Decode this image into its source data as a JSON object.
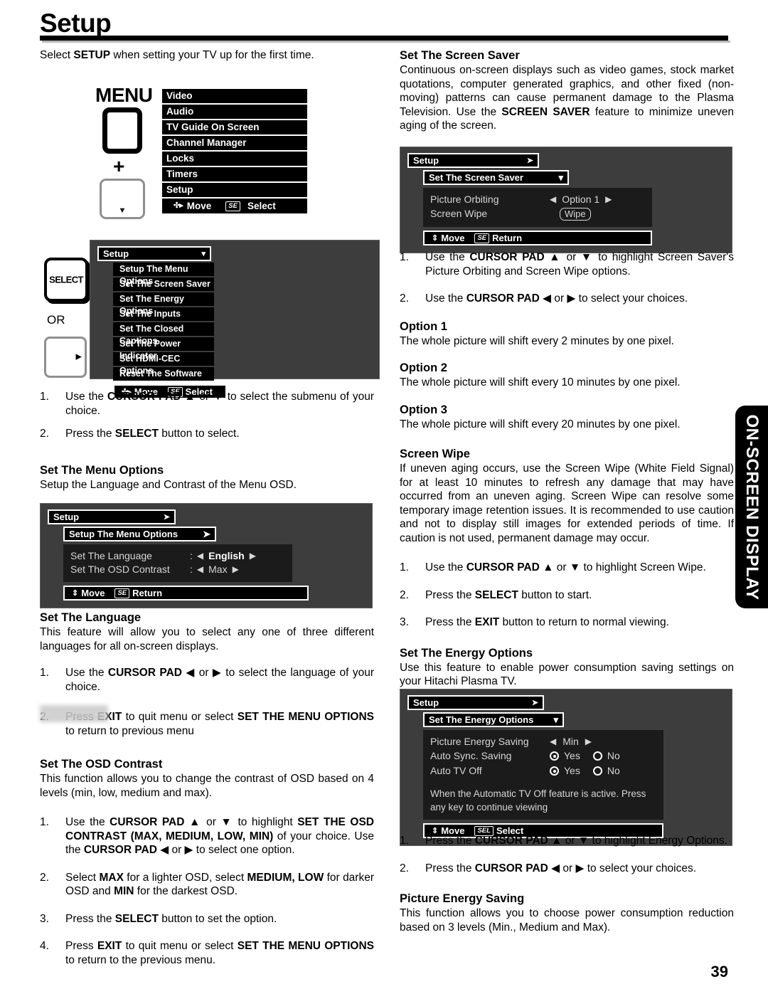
{
  "page": {
    "title": "Setup",
    "number": "39",
    "side_tab": "ON-SCREEN DISPLAY",
    "intro_pre": "Select ",
    "intro_bold": "SETUP",
    "intro_post": " when setting your TV up for the first time."
  },
  "remote": {
    "menu_label": "MENU",
    "plus": "+",
    "down_glyph": "▼",
    "select_label": "SELECT",
    "or_label": "OR",
    "right_glyph": "▶"
  },
  "menu_list": {
    "items": [
      "Video",
      "Audio",
      "TV Guide On Screen",
      "Channel Manager",
      "Locks",
      "Timers",
      "Setup"
    ],
    "move_label": "Move",
    "se_label": "SE",
    "select_label": "Select",
    "move_glyph": "✣▸"
  },
  "osd_setup_list": {
    "header": "Setup",
    "header_arrow": "▾",
    "items": [
      "Setup The Menu Options",
      "Set The Screen Saver",
      "Set The Energy Options",
      "Set The Inputs",
      "Set The Closed Captions",
      "Set The Power Indicator",
      "Set HDMI-CEC Options",
      "Reset The Software"
    ],
    "footer_move": "Move",
    "footer_se": "SE",
    "footer_action": "Select",
    "move_glyph": "✣▸"
  },
  "osd_menu_options": {
    "header": "Setup",
    "header_arrow": "➤",
    "sub": "Setup The Menu Options",
    "sub_arrow": "➤",
    "rows": [
      {
        "name": "Set The Language",
        "colon": ":",
        "left": "◀",
        "value": "English",
        "right": "▶"
      },
      {
        "name": "Set The OSD Contrast",
        "colon": ":",
        "left": "◀",
        "value": "Max",
        "right": "▶"
      }
    ],
    "footer_move": "Move",
    "footer_se": "SE",
    "footer_action": "Return",
    "move_glyph": "⇕"
  },
  "osd_screensaver": {
    "header": "Setup",
    "header_arrow": "➤",
    "sub": "Set The Screen Saver",
    "sub_arrow": "▾",
    "rows": [
      {
        "name": "Picture Orbiting",
        "left": "◀",
        "value": "Option 1",
        "right": "▶"
      },
      {
        "name": "Screen Wipe",
        "value": "Wipe"
      }
    ],
    "footer_move": "Move",
    "footer_se": "SE",
    "footer_action": "Return",
    "move_glyph": "⇕"
  },
  "osd_energy": {
    "header": "Setup",
    "header_arrow": "➤",
    "sub": "Set The Energy Options",
    "sub_arrow": "▾",
    "row_picture": {
      "name": "Picture Energy Saving",
      "left": "◀",
      "value": "Min",
      "right": "▶"
    },
    "row_sync": {
      "name": "Auto Sync. Saving",
      "yes": "Yes",
      "no": "No",
      "selected": "Yes"
    },
    "row_tvoff": {
      "name": "Auto TV Off",
      "yes": "Yes",
      "no": "No",
      "selected": "Yes"
    },
    "note": "When the Automatic TV Off feature is active. Press any key to continue viewing",
    "footer_move": "Move",
    "footer_se": "SEL",
    "footer_action": "Select",
    "move_glyph": "⇕"
  },
  "left_column": {
    "steps_a": [
      {
        "n": "1.",
        "html": "Use the <b>CURSOR PAD</b> ▲ or ▼ to select the submenu of your choice."
      },
      {
        "n": "2.",
        "html": "Press the <b>SELECT</b> button to select."
      }
    ],
    "menu_options_heading": "Set The Menu Options",
    "menu_options_body": "Setup the Language and Contrast of the Menu OSD.",
    "language_heading": "Set The Language",
    "language_body": "This feature will allow you to select any one of three different languages for all on-screen displays.",
    "language_steps": [
      {
        "n": "1.",
        "html": "Use the <b>CURSOR PAD</b> ◀ or ▶ to select the language of your choice."
      },
      {
        "n": "2.",
        "html": "Press <b>EXIT</b> to quit menu or select <b>SET THE MENU OPTIONS</b> to return to previous menu"
      }
    ],
    "contrast_heading": "Set The OSD Contrast",
    "contrast_body": "This function allows you to change the contrast of OSD based on 4 levels (min, low, medium and max).",
    "contrast_steps": [
      {
        "n": "1.",
        "html": "Use the <b>CURSOR PAD</b> ▲ or ▼ to highlight <b>SET THE OSD CONTRAST (MAX, MEDIUM, LOW, MIN)</b> of your choice. Use the <b>CURSOR PAD</b> ◀ or ▶ to select one option."
      },
      {
        "n": "2.",
        "html": "Select <b>MAX</b> for a lighter OSD, select <b>MEDIUM, LOW</b> for darker OSD and <b>MIN</b> for the darkest OSD."
      },
      {
        "n": "3.",
        "html": "Press the <b>SELECT</b> button to set the option."
      },
      {
        "n": "4.",
        "html": "Press <b>EXIT</b> to quit menu or select <b>SET THE MENU OPTIONS</b> to return to the previous menu."
      }
    ]
  },
  "right_column": {
    "screensaver_heading": "Set The Screen Saver",
    "screensaver_body": "Continuous on-screen displays such as video games, stock market quotations, computer generated graphics, and other fixed (non-moving) patterns can cause permanent damage to the Plasma Television. Use the <b>SCREEN SAVER</b> feature to minimize uneven aging of the screen.",
    "screensaver_steps": [
      {
        "n": "1.",
        "html": "Use the <b>CURSOR PAD</b> ▲ or ▼ to highlight Screen Saver's Picture Orbiting and Screen Wipe options."
      },
      {
        "n": "2.",
        "html": "Use the <b>CURSOR PAD</b> ◀ or ▶ to select your choices."
      }
    ],
    "options": [
      {
        "heading": "Option 1",
        "body": "The whole picture will shift every 2 minutes by one pixel."
      },
      {
        "heading": "Option 2",
        "body": "The whole picture will shift every 10 minutes by one pixel."
      },
      {
        "heading": "Option 3",
        "body": "The whole picture will shift every 20 minutes by one pixel."
      }
    ],
    "wipe_heading": "Screen Wipe",
    "wipe_body": "If uneven aging occurs, use the Screen Wipe (White Field Signal) for at least 10 minutes to refresh any damage that may have occurred from an uneven aging. Screen Wipe can resolve some temporary image retention issues. It is recommended to use caution and not to display still images for extended periods of time. If caution is not used, permanent damage may occur.",
    "wipe_steps": [
      {
        "n": "1.",
        "html": "Use the <b>CURSOR PAD</b> ▲ or ▼ to highlight Screen Wipe."
      },
      {
        "n": "2.",
        "html": "Press the <b>SELECT</b> button to start."
      },
      {
        "n": "3.",
        "html": "Press the <b>EXIT</b> button to return to normal viewing."
      }
    ],
    "energy_heading": "Set The Energy Options",
    "energy_body": "Use this feature to enable power consumption saving settings on your Hitachi Plasma TV.",
    "energy_steps": [
      {
        "n": "1.",
        "html": "Press the <b>CURSOR PAD</b> ▲ or ▼ to highlight Energy Options."
      },
      {
        "n": "2.",
        "html": "Press the <b>CURSOR PAD</b> ◀ or ▶ to select your choices."
      }
    ],
    "pes_heading": "Picture Energy Saving",
    "pes_body": "This function allows you to choose power consumption reduction based on 3 levels (Min., Medium and Max)."
  }
}
